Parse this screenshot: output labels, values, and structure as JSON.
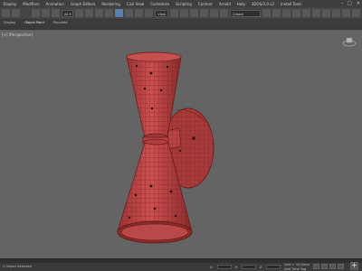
{
  "menubar": {
    "items": [
      "Display",
      "Modifiers",
      "Animation",
      "Graph Editors",
      "Rendering",
      "Civil View",
      "Customize",
      "Scripting",
      "Content",
      "Arnold",
      "Help",
      "3DOS/3.0 v2",
      "Install Tools"
    ],
    "window_controls": [
      "–",
      "□",
      "✕"
    ]
  },
  "toolbar": {
    "view_dropdown": "View",
    "selection_set": "Create Selection Se"
  },
  "ribbon": {
    "tabs": [
      "Display",
      "Object Paint",
      "Populate"
    ]
  },
  "viewport": {
    "label": "[+] [Perspective]",
    "object_color": "#c24848",
    "wire_color": "#7a1d1d",
    "background": "#646464"
  },
  "viewcube": {
    "icon": "viewcube-icon"
  },
  "status": {
    "selection": "1 Object Selected",
    "coord_labels": [
      "X:",
      "Y:",
      "Z:"
    ],
    "grid": "Grid = 10,0mm",
    "tag_label": "Add Time Tag"
  }
}
